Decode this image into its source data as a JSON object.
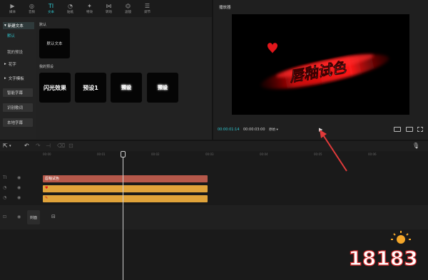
{
  "toolbar": {
    "items": [
      {
        "label": "媒体",
        "icon": "media-icon"
      },
      {
        "label": "音频",
        "icon": "audio-icon"
      },
      {
        "label": "文本",
        "icon": "text-icon"
      },
      {
        "label": "贴纸",
        "icon": "sticker-icon"
      },
      {
        "label": "特效",
        "icon": "effects-icon"
      },
      {
        "label": "转场",
        "icon": "transition-icon"
      },
      {
        "label": "滤镜",
        "icon": "filter-icon"
      },
      {
        "label": "调节",
        "icon": "adjust-icon"
      }
    ],
    "active_index": 2
  },
  "sidebar": {
    "new_text": "新建文本",
    "default": "默认",
    "my_presets": "我的预设",
    "flower_text": "花字",
    "text_templates": "文字模板",
    "smart_captions": "智能字幕",
    "lyrics": "识别歌词",
    "local_captions": "本地字幕"
  },
  "content": {
    "default_section": "默认",
    "default_text_tile": "默认文本",
    "presets_section": "我的预设",
    "presets": [
      "闪光效果",
      "预设1",
      "预设",
      "预设"
    ]
  },
  "player": {
    "title": "播放器",
    "overlay_text": "唇釉试色",
    "time_current": "00:00:01:14",
    "time_total": "00:00:03:00",
    "ratio": "原始"
  },
  "timeline": {
    "ticks": [
      "00:00",
      "00:01",
      "00:02",
      "00:03",
      "00:04",
      "00:05",
      "00:06"
    ],
    "text_clip": "唇釉试色",
    "cover_label": "封面"
  },
  "colors": {
    "accent": "#2ec5ce",
    "text_clip": "#b5584a",
    "effect_clip": "#e0a33a",
    "annotation_arrow": "#e13a3a"
  },
  "watermark": "18183"
}
